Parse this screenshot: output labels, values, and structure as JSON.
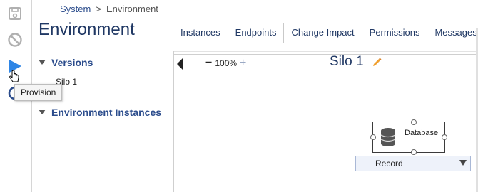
{
  "breadcrumb": {
    "root": "System",
    "separator": ">",
    "current": "Environment"
  },
  "page_title": "Environment",
  "tabs": [
    "Instances",
    "Endpoints",
    "Change Impact",
    "Permissions",
    "Messages"
  ],
  "toolbar": {
    "buttons": [
      {
        "name": "save-icon",
        "state": "disabled"
      },
      {
        "name": "cancel-icon",
        "state": "disabled"
      },
      {
        "name": "play-icon",
        "state": "hover"
      },
      {
        "name": "refresh-icon",
        "state": "enabled"
      }
    ],
    "tooltip": "Provision"
  },
  "left_panel": {
    "versions_title": "Versions",
    "versions": [
      "Silo 1"
    ],
    "instances_title": "Environment Instances"
  },
  "canvas": {
    "zoom": "100%",
    "title": "Silo 1",
    "node_label": "Database",
    "dropdown_value": "Record"
  },
  "colors": {
    "accent": "#2b4c8c",
    "play": "#2f86e6",
    "edit": "#f0a030"
  }
}
